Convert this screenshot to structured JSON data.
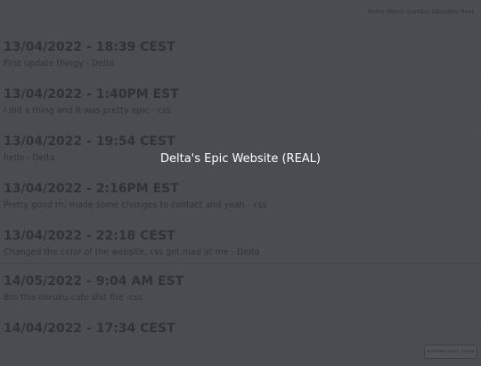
{
  "header": {
    "logo": "~",
    "nav": [
      "Home",
      "About",
      "Contact",
      "Episodes",
      "Rant"
    ]
  },
  "entries": [
    {
      "date": "13/04/2022 - 18:39 CEST",
      "text": "First update thingy - Delta"
    },
    {
      "date": "13/04/2022 - 1:40PM EST",
      "text": "I did a thing and it was pretty epic - css"
    },
    {
      "date": "13/04/2022 - 19:54 CEST",
      "text": "hello - Delta"
    },
    {
      "date": "13/04/2022 - 2:16PM EST",
      "text": "Pretty good rn, made some changes to contact and yeah - css"
    },
    {
      "date": "13/04/2022 - 22:18 CEST",
      "text": "Changed the color of the website, css got mad at me - Delta"
    },
    {
      "date": "14/05/2022 - 9:04 AM EST",
      "text": "Bro this miruku.cafe shit fire -css"
    },
    {
      "date": "14/04/2022 - 17:34 CEST",
      "text": ""
    }
  ],
  "overlay": {
    "title": "Delta's Epic Website (REAL)"
  },
  "corner_button": {
    "label": "Activate dark mode"
  },
  "colors": {
    "background": "#4b4d53",
    "overlay_text": "#ffffff"
  }
}
